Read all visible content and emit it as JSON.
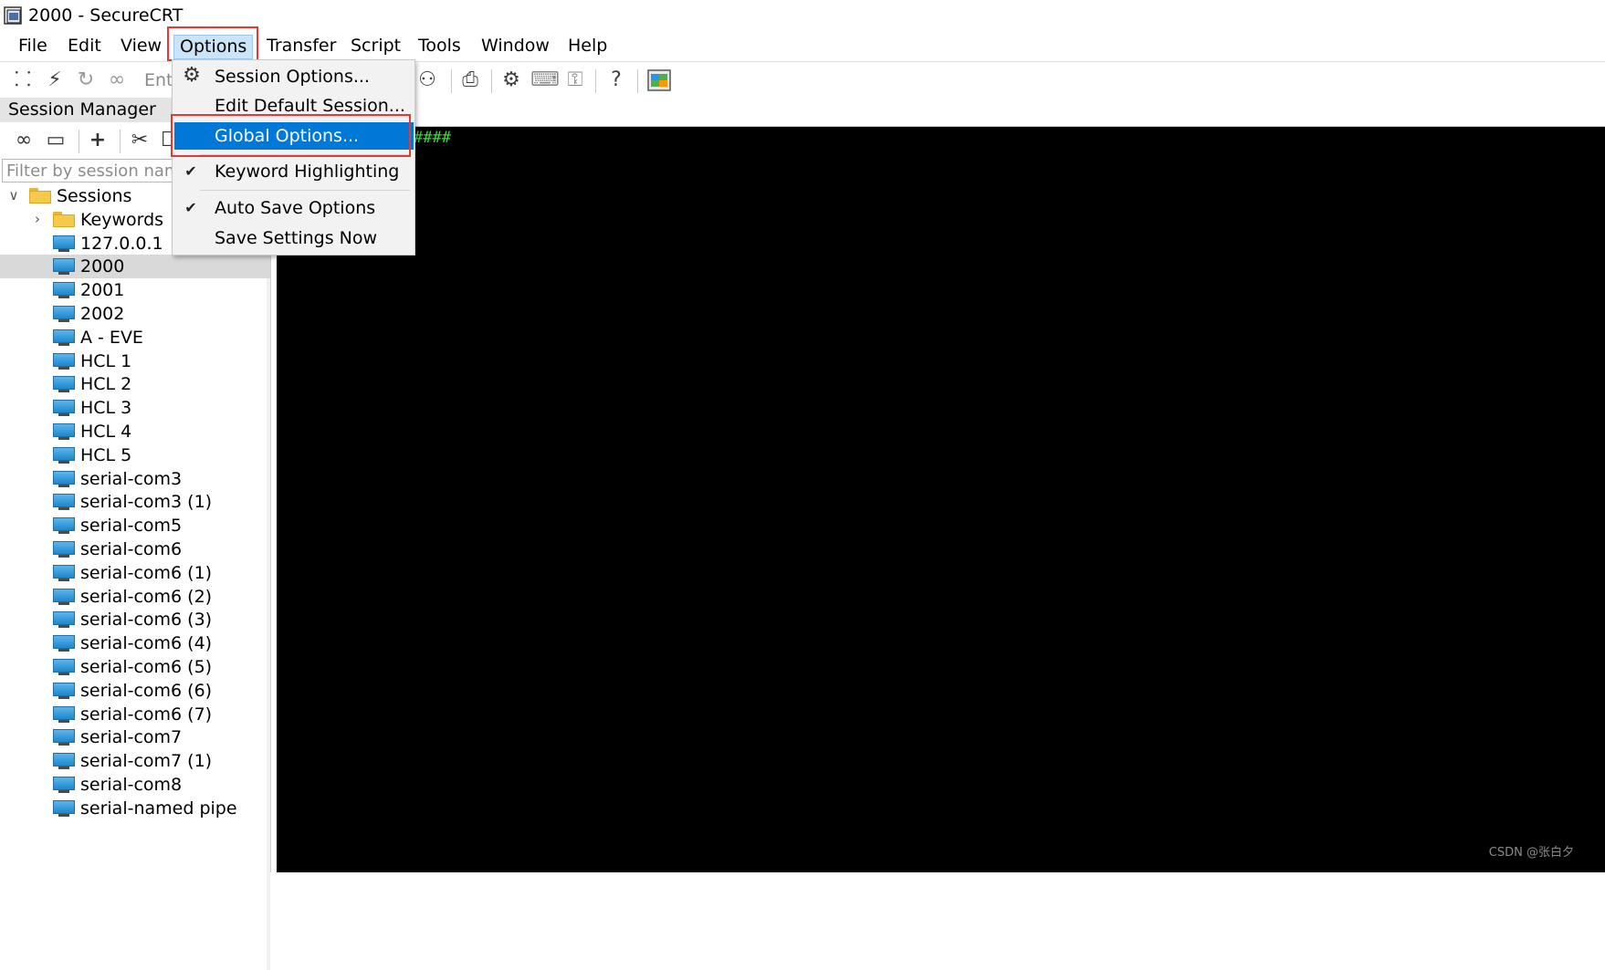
{
  "window": {
    "title": "2000 - SecureCRT"
  },
  "menubar": {
    "items": [
      {
        "label": "File"
      },
      {
        "label": "Edit"
      },
      {
        "label": "View"
      },
      {
        "label": "Options"
      },
      {
        "label": "Transfer"
      },
      {
        "label": "Script"
      },
      {
        "label": "Tools"
      },
      {
        "label": "Window"
      },
      {
        "label": "Help"
      }
    ]
  },
  "toolbar": {
    "enter_label": "Ente"
  },
  "options_menu": {
    "items": [
      {
        "label": "Session Options...",
        "icon": "gear-icon"
      },
      {
        "label": "Edit Default Session..."
      },
      {
        "label": "Global Options..."
      },
      {
        "label": "Keyword Highlighting",
        "checked": true
      },
      {
        "label": "Auto Save Options",
        "checked": true
      },
      {
        "label": "Save Settings Now"
      }
    ]
  },
  "session_manager": {
    "title": "Session Manager",
    "filter_placeholder": "Filter by session name",
    "tree": {
      "root": "Sessions",
      "folder": "Keywords",
      "sessions": [
        "127.0.0.1",
        "2000",
        "2001",
        "2002",
        "A - EVE",
        "HCL 1",
        "HCL 2",
        "HCL 3",
        "HCL 4",
        "HCL 5",
        "serial-com3",
        "serial-com3 (1)",
        "serial-com5",
        "serial-com6",
        "serial-com6 (1)",
        "serial-com6 (2)",
        "serial-com6 (3)",
        "serial-com6 (4)",
        "serial-com6 (5)",
        "serial-com6 (6)",
        "serial-com6 (7)",
        "serial-com7",
        "serial-com7 (1)",
        "serial-com8",
        "serial-named pipe"
      ],
      "selected": "2000"
    }
  },
  "terminal": {
    "visible_text": "####"
  },
  "watermark": "CSDN @张白夕",
  "colors": {
    "menu_active": "#0078d7",
    "highlight_box": "#e53935",
    "terminal_bg": "#000000",
    "terminal_fg": "#35e035"
  }
}
